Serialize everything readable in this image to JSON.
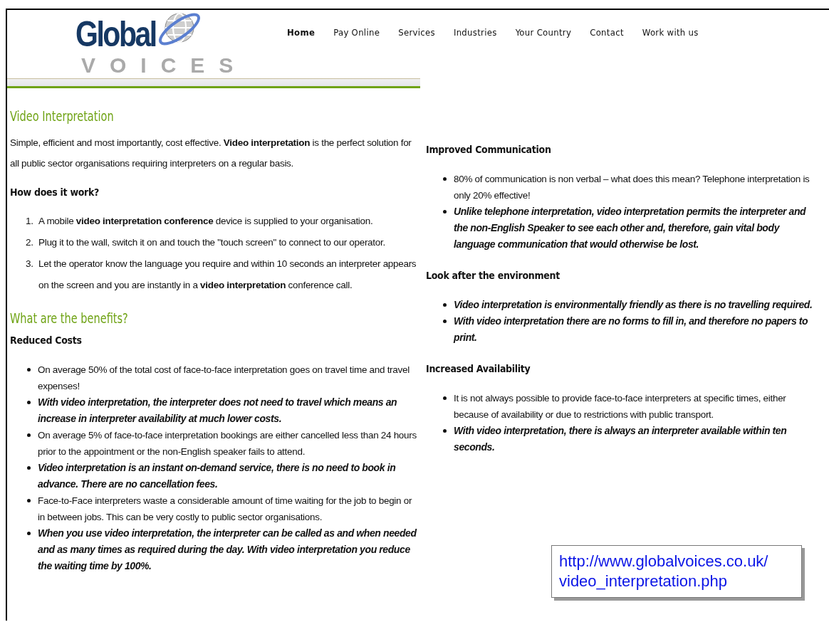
{
  "logo": {
    "word": "Global",
    "tagline": "VOICES"
  },
  "nav": [
    {
      "label": "Home",
      "selected": true
    },
    {
      "label": "Pay Online",
      "selected": false
    },
    {
      "label": "Services",
      "selected": false
    },
    {
      "label": "Industries",
      "selected": false
    },
    {
      "label": "Your Country",
      "selected": false
    },
    {
      "label": "Contact",
      "selected": false
    },
    {
      "label": "Work with us",
      "selected": false
    }
  ],
  "left": {
    "title": "Video Interpretation",
    "intro": "Simple, efficient and most importantly, cost effective. **Video interpretation** is the perfect solution for all public sector organisations requiring interpreters on a regular basis.",
    "how_heading": "How does it work?",
    "steps": [
      {
        "number": "1.",
        "text": "A mobile **video interpretation conference** device is supplied to your organisation."
      },
      {
        "number": "2.",
        "text": "Plug it to the wall, switch it on and touch the \"touch screen\" to connect to our operator."
      },
      {
        "number": "3.",
        "text": "Let the operator know the language you require and within 10 seconds an interpreter appears on the screen and you are instantly in a **video interpretation** conference call."
      }
    ],
    "benefits_title": "What are the benefits?",
    "sections": [
      {
        "heading": "Reduced Costs",
        "bullets": [
          {
            "text": "On average 50% of the total cost of face-to-face interpretation goes on travel time and travel expenses!",
            "emphasis": false
          },
          {
            "text": "With video interpretation, the interpreter does not need to travel which means an increase in interpreter availability at much lower costs.",
            "emphasis": true
          },
          {
            "text": "On average 5% of face-to-face interpretation bookings are either cancelled less than 24 hours prior to the appointment or the non-English speaker fails to attend.",
            "emphasis": false
          },
          {
            "text": "Video interpretation is an instant on-demand service, there is no need to book in advance. There are no cancellation fees.",
            "emphasis": true
          },
          {
            "text": "Face-to-Face interpreters waste a considerable amount of time waiting for the job to begin or in between jobs. This can be very costly to public sector organisations.",
            "emphasis": false
          },
          {
            "text": "When you use video interpretation, the interpreter can be called as and when needed and as many times as required during the day. With video interpretation you reduce the waiting time by 100%.",
            "emphasis": true
          }
        ]
      }
    ]
  },
  "right": {
    "sections": [
      {
        "heading": "Improved Communication",
        "bullets": [
          {
            "text": "80% of communication is non verbal – what does this mean? Telephone interpretation is only 20% effective!",
            "emphasis": false
          },
          {
            "text": "Unlike telephone interpretation, video interpretation permits the interpreter and the non-English Speaker to see each other and, therefore, gain vital body language communication that would otherwise be lost.",
            "emphasis": true
          }
        ]
      },
      {
        "heading": "Look after the environment",
        "bullets": [
          {
            "text": "Video interpretation is environmentally friendly as there is no travelling required.",
            "emphasis": true
          },
          {
            "text": "With video interpretation there are no forms to fill in, and therefore no papers to print.",
            "emphasis": true
          }
        ]
      },
      {
        "heading": "Increased Availability",
        "bullets": [
          {
            "text": "It is not always possible to provide face-to-face interpreters at specific times, either because of availability or due to restrictions with public transport.",
            "emphasis": false
          },
          {
            "text": "With video interpretation, there is always an interpreter available within ten seconds.",
            "emphasis": true
          }
        ]
      }
    ]
  },
  "callout": {
    "lines": [
      "http://www.globalvoices.co.uk/",
      "video_interpretation.php"
    ]
  }
}
